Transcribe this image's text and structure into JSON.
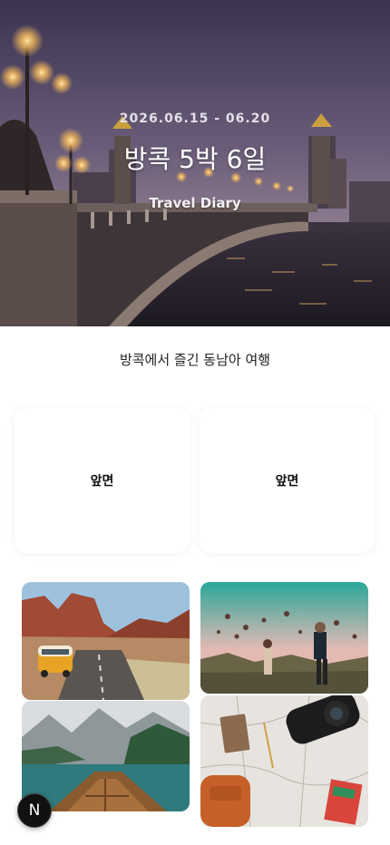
{
  "hero": {
    "dates": "2026.06.15 - 06.20",
    "title": "방콕 5박 6일",
    "subtitle": "Travel Diary"
  },
  "trip_description": "방콕에서 즐긴 동남아 여행",
  "cards": [
    {
      "label": "앞면"
    },
    {
      "label": "앞면"
    }
  ],
  "gallery": [
    {
      "icon": "desert-road-van-photo"
    },
    {
      "icon": "hot-air-balloons-photo"
    },
    {
      "icon": "mountain-lake-boat-photo"
    },
    {
      "icon": "travel-flatlay-map-photo"
    }
  ],
  "badge": {
    "label": "N"
  },
  "colors": {
    "sky_top": "#3d3550",
    "sky_bottom": "#7a6a86",
    "river": "#2b2430"
  }
}
